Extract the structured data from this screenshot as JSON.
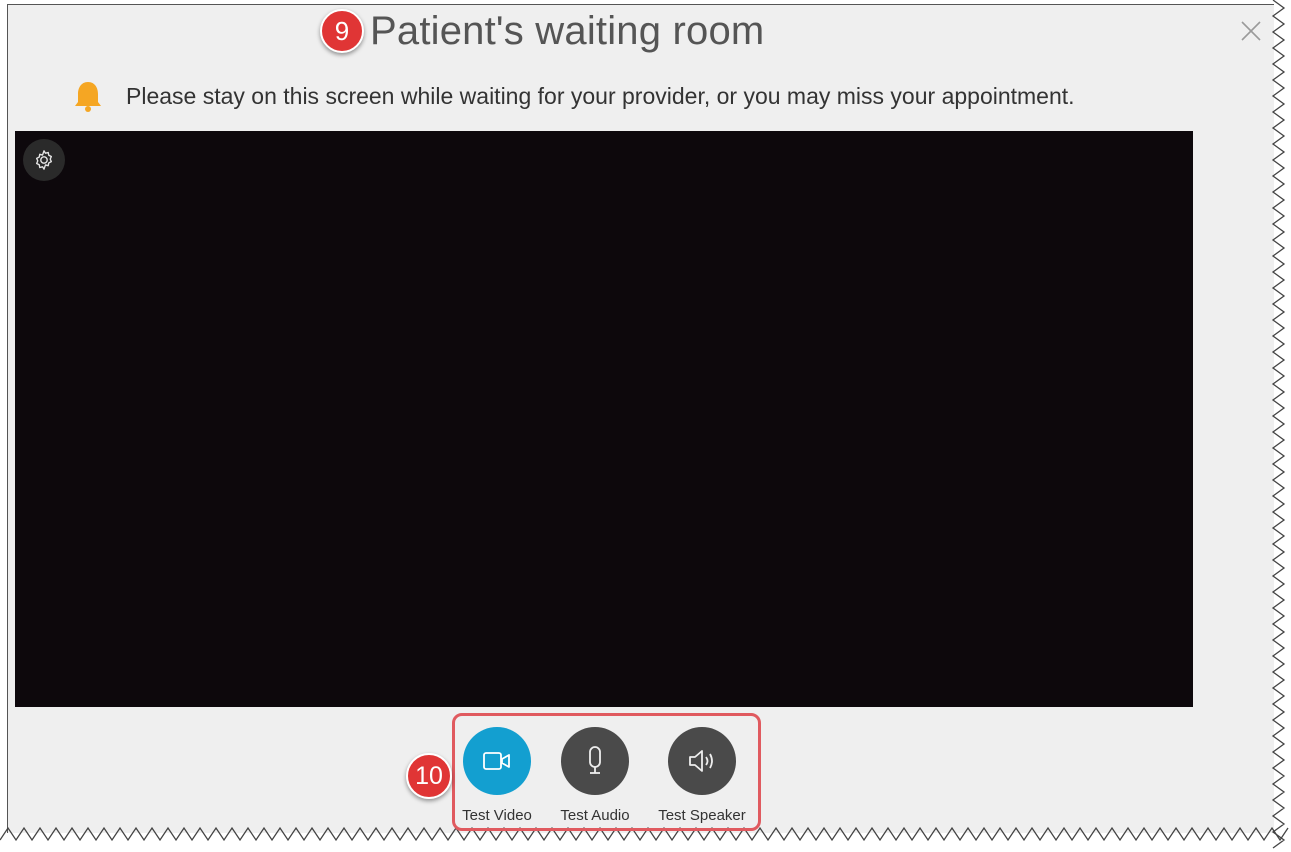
{
  "header": {
    "step_badge": "9",
    "title": "Patient's waiting room",
    "close_icon": "close-icon"
  },
  "notice": {
    "icon": "bell-icon",
    "text": "Please stay on this screen while waiting for your provider, or you may miss your appointment."
  },
  "video": {
    "settings_icon": "gear-icon"
  },
  "controls": {
    "step_badge": "10",
    "test_video_label": "Test Video",
    "test_audio_label": "Test Audio",
    "test_speaker_label": "Test Speaker"
  },
  "colors": {
    "accent_blue": "#139fd0",
    "badge_red": "#e03535",
    "highlight_border": "#e05a5f",
    "bell_orange": "#f5a623"
  }
}
